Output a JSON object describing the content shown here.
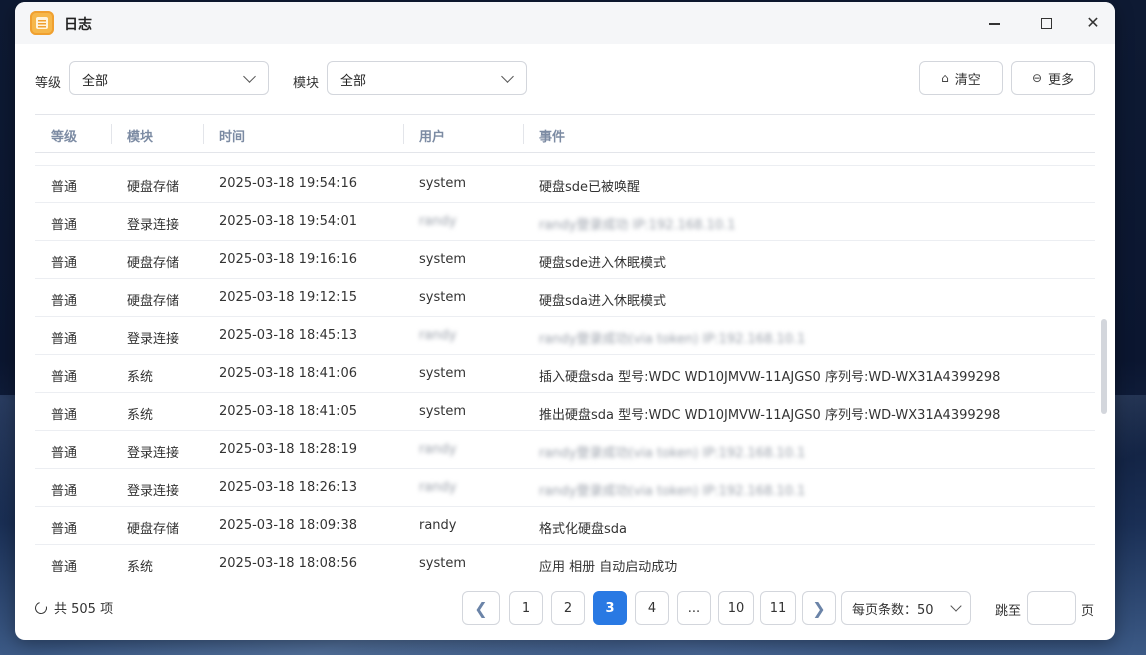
{
  "window": {
    "title": "日志",
    "controls": {
      "minimize": "minimize-icon",
      "maximize": "maximize-icon",
      "close": "close-icon",
      "close_glyph": "✕"
    }
  },
  "filters": {
    "level_label": "等级",
    "level_value": "全部",
    "module_label": "模块",
    "module_value": "全部"
  },
  "toolbar": {
    "clear_label": "清空",
    "more_label": "更多"
  },
  "table": {
    "columns": [
      "等级",
      "模块",
      "时间",
      "用户",
      "事件"
    ],
    "rows": [
      {
        "level": "普通",
        "module": "硬盘存储",
        "time": "2025-03-18 19:54:16",
        "user": "system",
        "event": "硬盘sde已被唤醒"
      },
      {
        "level": "普通",
        "module": "登录连接",
        "time": "2025-03-18 19:54:01",
        "user": "randy",
        "event": "randy登录成功 IP:192.168.10.1",
        "blurred": true
      },
      {
        "level": "普通",
        "module": "硬盘存储",
        "time": "2025-03-18 19:16:16",
        "user": "system",
        "event": "硬盘sde进入休眠模式"
      },
      {
        "level": "普通",
        "module": "硬盘存储",
        "time": "2025-03-18 19:12:15",
        "user": "system",
        "event": "硬盘sda进入休眠模式"
      },
      {
        "level": "普通",
        "module": "登录连接",
        "time": "2025-03-18 18:45:13",
        "user": "randy",
        "event": "randy登录成功(via token) IP:192.168.10.1",
        "blurred": true
      },
      {
        "level": "普通",
        "module": "系统",
        "time": "2025-03-18 18:41:06",
        "user": "system",
        "event": "插入硬盘sda 型号:WDC WD10JMVW-11AJGS0 序列号:WD-WX31A4399298"
      },
      {
        "level": "普通",
        "module": "系统",
        "time": "2025-03-18 18:41:05",
        "user": "system",
        "event": "推出硬盘sda 型号:WDC WD10JMVW-11AJGS0 序列号:WD-WX31A4399298"
      },
      {
        "level": "普通",
        "module": "登录连接",
        "time": "2025-03-18 18:28:19",
        "user": "randy",
        "event": "randy登录成功(via token) IP:192.168.10.1",
        "blurred": true
      },
      {
        "level": "普通",
        "module": "登录连接",
        "time": "2025-03-18 18:26:13",
        "user": "randy",
        "event": "randy登录成功(via token) IP:192.168.10.1",
        "blurred": true
      },
      {
        "level": "普通",
        "module": "硬盘存储",
        "time": "2025-03-18 18:09:38",
        "user": "randy",
        "event": "格式化硬盘sda"
      },
      {
        "level": "普通",
        "module": "系统",
        "time": "2025-03-18 18:08:56",
        "user": "system",
        "event": "应用 相册 自动启动成功"
      }
    ]
  },
  "footer": {
    "total_label": "共 505 项",
    "pages": [
      "1",
      "2",
      "3",
      "4",
      "...",
      "10",
      "11"
    ],
    "current_page": "3",
    "prev_glyph": "❮",
    "next_glyph": "❯",
    "page_size_label": "每页条数：50",
    "jump_label": "跳至",
    "jump_suffix": "页"
  },
  "colors": {
    "accent": "#2979e3",
    "header_text": "#7c8ba3"
  }
}
